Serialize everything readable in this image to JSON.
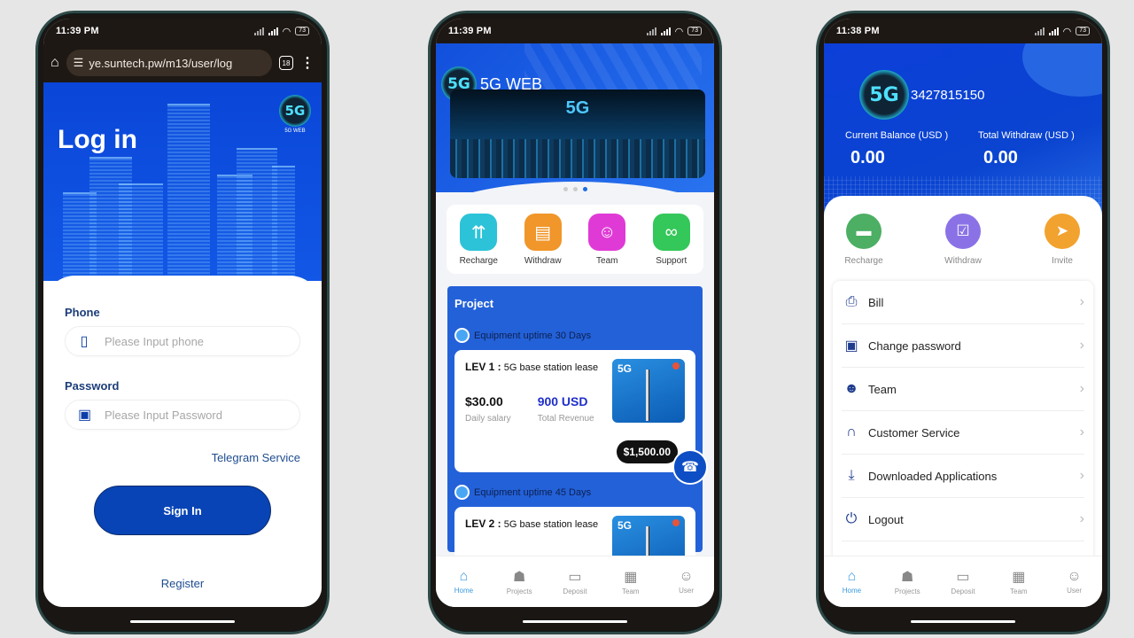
{
  "phones": {
    "login": {
      "status": {
        "time": "11:39 PM",
        "battery": "73"
      },
      "browser": {
        "url": "ye.suntech.pw/m13/user/log",
        "tab_count": "18"
      },
      "title": "Log in",
      "logo": {
        "mark": "5G",
        "caption": "5G WEB"
      },
      "phone_label": "Phone",
      "phone_placeholder": "Please Input phone",
      "password_label": "Password",
      "password_placeholder": "Please Input Password",
      "telegram_link": "Telegram Service",
      "signin_button": "Sign In",
      "register_link": "Register"
    },
    "home": {
      "status": {
        "time": "11:39 PM",
        "battery": "73"
      },
      "brand": {
        "mark": "5G",
        "name": "5G WEB"
      },
      "banner_text": "5G",
      "carousel": {
        "count": 3,
        "active": 3
      },
      "quick_actions": [
        {
          "label": "Recharge",
          "icon": "upload-arrows-icon",
          "color": "#2cc3d8"
        },
        {
          "label": "Withdraw",
          "icon": "folder-icon",
          "color": "#f0962a"
        },
        {
          "label": "Team",
          "icon": "users-icon",
          "color": "#e03ad6"
        },
        {
          "label": "Support",
          "icon": "link-icon",
          "color": "#34c759"
        }
      ],
      "project": {
        "title": "Project",
        "groups": [
          {
            "uptime": "Equipment uptime 30 Days",
            "level": "LEV 1 :",
            "desc": "5G base station lease",
            "daily": "$30.00",
            "daily_label": "Daily salary",
            "revenue": "900 USD",
            "revenue_label": "Total Revenue",
            "price": "$1,500.00",
            "badge": "5G"
          },
          {
            "uptime": "Equipment uptime 45 Days",
            "level": "LEV 2 :",
            "desc": "5G base station lease",
            "badge": "5G"
          }
        ]
      },
      "tabbar": [
        {
          "label": "Home",
          "icon": "home-icon",
          "active": true
        },
        {
          "label": "Projects",
          "icon": "cart-icon",
          "active": false
        },
        {
          "label": "Deposit",
          "icon": "wallet-icon",
          "active": false
        },
        {
          "label": "Team",
          "icon": "gift-icon",
          "active": false
        },
        {
          "label": "User",
          "icon": "user-icon",
          "active": false
        }
      ]
    },
    "user": {
      "status": {
        "time": "11:38 PM",
        "battery": "73"
      },
      "logo": {
        "mark": "5G"
      },
      "user_id": "3427815150",
      "balance_label": "Current Balance (USD )",
      "balance_value": "0.00",
      "withdraw_label": "Total Withdraw (USD )",
      "withdraw_value": "0.00",
      "actions": [
        {
          "label": "Recharge",
          "icon": "card-icon",
          "color": "#4caf63"
        },
        {
          "label": "Withdraw",
          "icon": "document-check-icon",
          "color": "#8a72e6"
        },
        {
          "label": "Invite",
          "icon": "paper-plane-icon",
          "color": "#f2a22e"
        }
      ],
      "menu": [
        {
          "label": "Bill",
          "icon": "bill-icon"
        },
        {
          "label": "Change password",
          "icon": "lock-icon"
        },
        {
          "label": "Team",
          "icon": "team-icon"
        },
        {
          "label": "Customer Service",
          "icon": "headset-icon"
        },
        {
          "label": "Downloaded Applications",
          "icon": "download-icon"
        },
        {
          "label": "Logout",
          "icon": "power-icon"
        }
      ],
      "tabbar": [
        {
          "label": "Home",
          "icon": "home-icon",
          "active": true
        },
        {
          "label": "Projects",
          "icon": "cart-icon",
          "active": false
        },
        {
          "label": "Deposit",
          "icon": "wallet-icon",
          "active": false
        },
        {
          "label": "Team",
          "icon": "gift-icon",
          "active": false
        },
        {
          "label": "User",
          "icon": "user-icon",
          "active": false
        }
      ]
    }
  }
}
